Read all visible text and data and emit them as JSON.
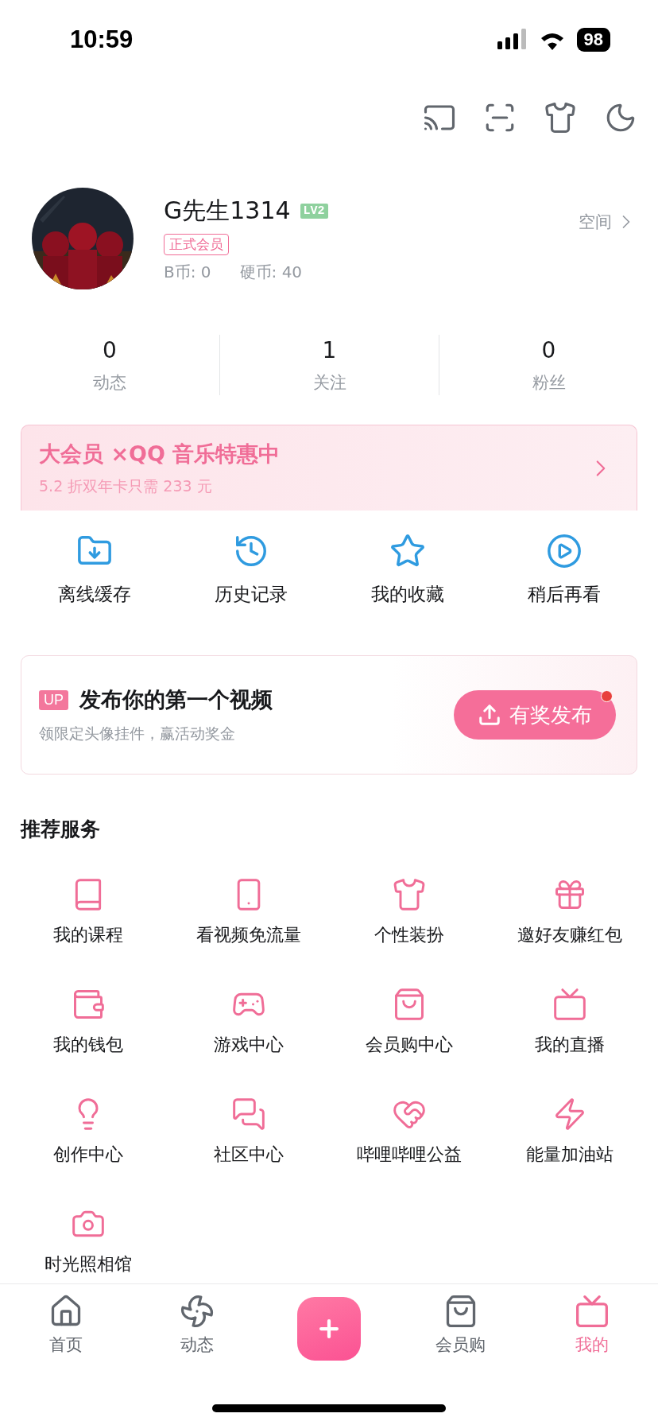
{
  "status_bar": {
    "time": "10:59",
    "battery": "98"
  },
  "profile": {
    "name": "G先生1314",
    "level": "LV2",
    "badge": "正式会员",
    "coins": [
      "B币: 0",
      "硬币: 40"
    ],
    "space_link": "空间"
  },
  "stats": [
    {
      "value": "0",
      "label": "动态"
    },
    {
      "value": "1",
      "label": "关注"
    },
    {
      "value": "0",
      "label": "粉丝"
    }
  ],
  "promo_banner": {
    "title": "大会员 ×QQ 音乐特惠中",
    "subtitle": "5.2 折双年卡只需 233 元"
  },
  "quick_actions": [
    "离线缓存",
    "历史记录",
    "我的收藏",
    "稍后再看"
  ],
  "upload_card": {
    "tag": "UP",
    "title": "发布你的第一个视频",
    "subtitle": "领限定头像挂件，赢活动奖金",
    "button": "有奖发布",
    "notice_dot": true
  },
  "services": {
    "title": "推荐服务",
    "items": [
      "我的课程",
      "看视频免流量",
      "个性装扮",
      "邀好友赚红包",
      "我的钱包",
      "游戏中心",
      "会员购中心",
      "我的直播",
      "创作中心",
      "社区中心",
      "哔哩哔哩公益",
      "能量加油站",
      "时光照相馆"
    ]
  },
  "tab_bar": [
    {
      "kind": "tab",
      "label": "首页",
      "selected": false
    },
    {
      "kind": "tab",
      "label": "动态",
      "selected": false
    },
    {
      "kind": "publish",
      "selected": false
    },
    {
      "kind": "tab",
      "label": "会员购",
      "selected": false
    },
    {
      "kind": "tab",
      "label": "我的",
      "selected": true
    }
  ]
}
